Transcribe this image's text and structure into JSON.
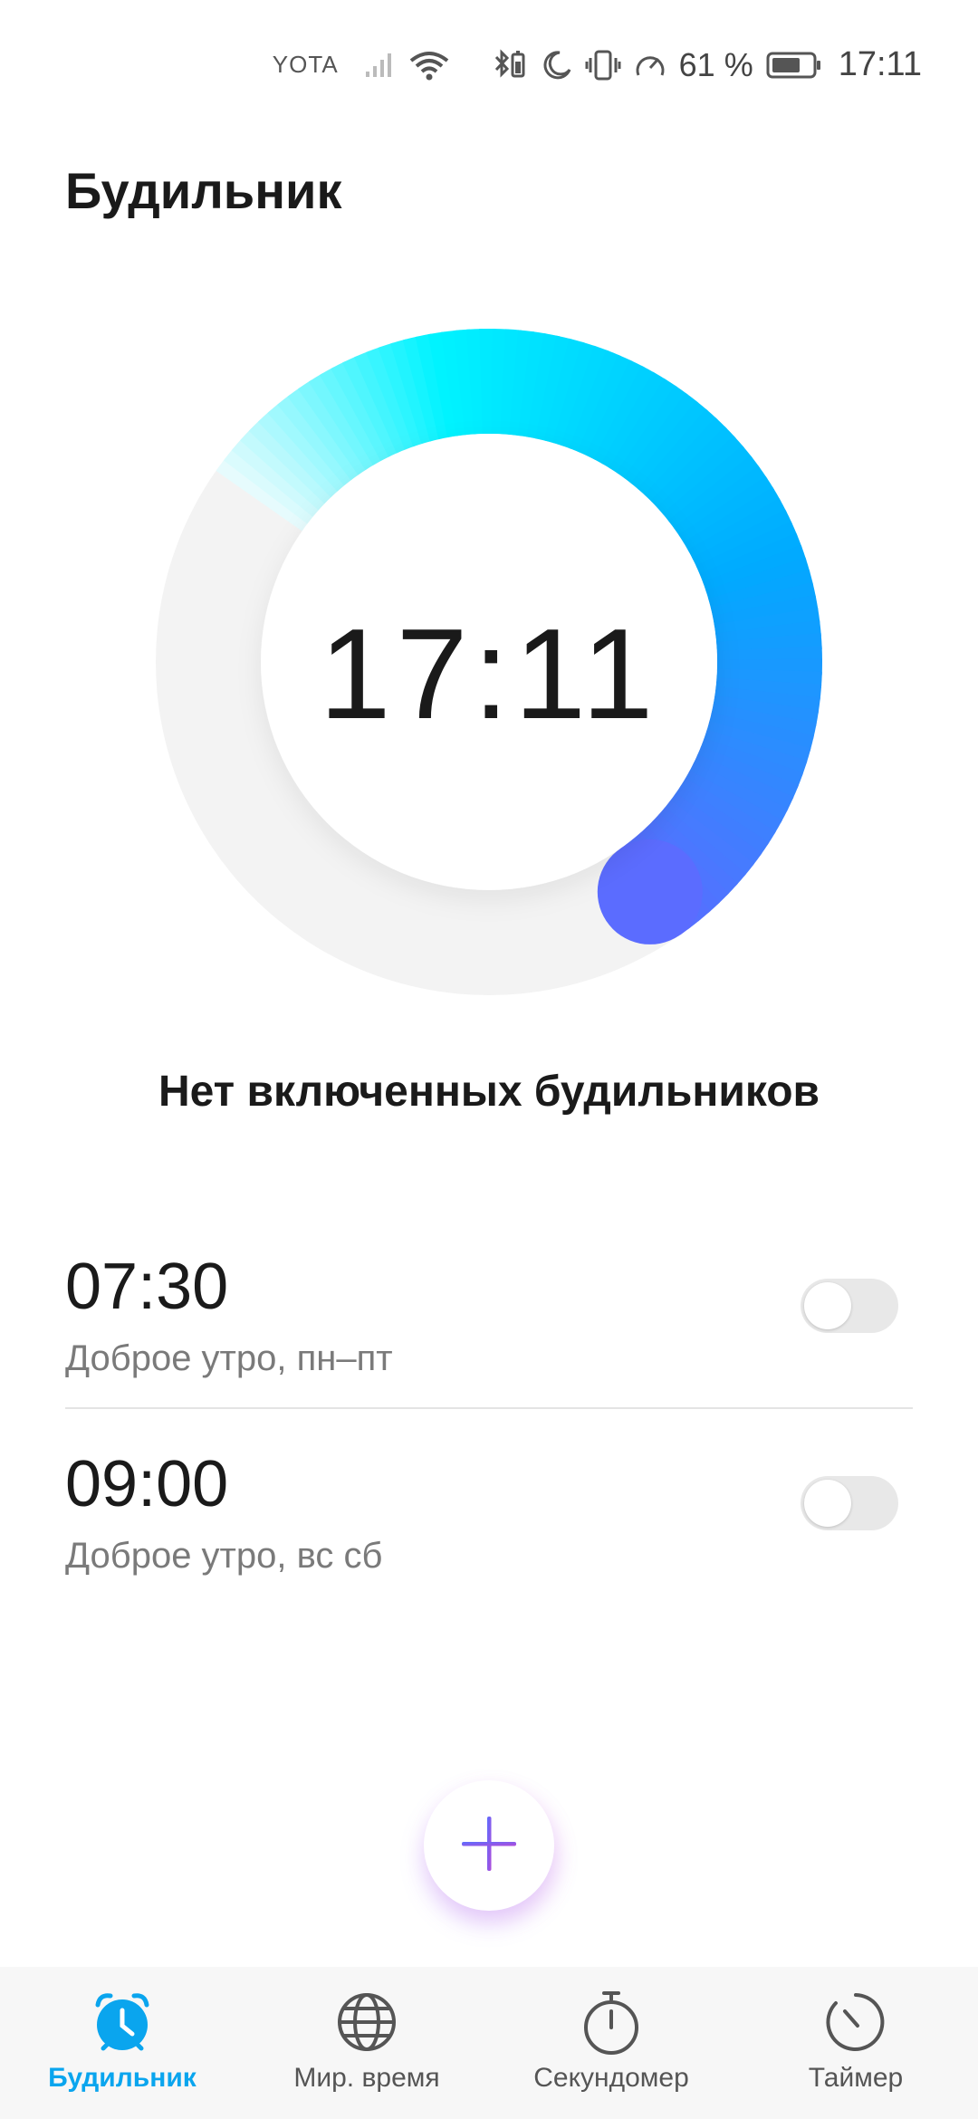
{
  "status_bar": {
    "carrier": "YOTA",
    "battery_percent": "61 %",
    "time": "17:11",
    "icons": [
      "signal-icon",
      "wifi-icon",
      "bluetooth-battery-icon",
      "do-not-disturb-icon",
      "vibrate-icon",
      "data-saver-icon",
      "battery-icon"
    ]
  },
  "page": {
    "title": "Будильник"
  },
  "dial": {
    "time": "17:11",
    "progress": 0.5
  },
  "empty_message": "Нет включенных будильников",
  "alarms": [
    {
      "time": "07:30",
      "label": "Доброе утро, пн–пт",
      "enabled": false
    },
    {
      "time": "09:00",
      "label": "Доброе утро, вс сб",
      "enabled": false
    }
  ],
  "fab": {
    "icon": "plus-icon"
  },
  "nav": [
    {
      "label": "Будильник",
      "icon": "alarm-clock-icon",
      "active": true
    },
    {
      "label": "Мир. время",
      "icon": "globe-icon",
      "active": false
    },
    {
      "label": "Секундомер",
      "icon": "stopwatch-icon",
      "active": false
    },
    {
      "label": "Таймер",
      "icon": "timer-icon",
      "active": false
    }
  ],
  "colors": {
    "accent": "#0aa5ee",
    "ring_start": "#e6fbfd",
    "ring_mid": "#00f3ff",
    "ring_blue": "#00aaff",
    "ring_end": "#5b6cff",
    "track": "#f2f2f2"
  }
}
